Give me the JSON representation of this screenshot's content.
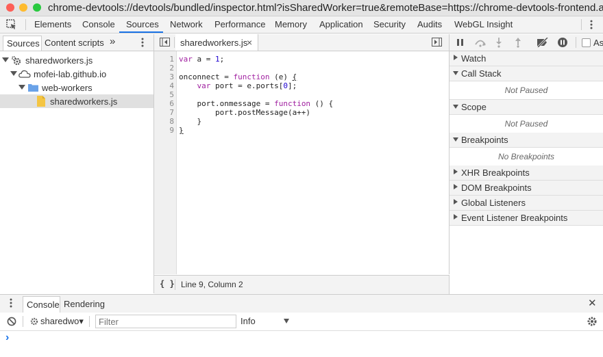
{
  "window": {
    "title": "chrome-devtools://devtools/bundled/inspector.html?isSharedWorker=true&remoteBase=https://chrome-devtools-frontend.appspo..."
  },
  "main_tabs": [
    {
      "label": "Elements"
    },
    {
      "label": "Console"
    },
    {
      "label": "Sources"
    },
    {
      "label": "Network"
    },
    {
      "label": "Performance"
    },
    {
      "label": "Memory"
    },
    {
      "label": "Application"
    },
    {
      "label": "Security"
    },
    {
      "label": "Audits"
    },
    {
      "label": "WebGL Insight"
    }
  ],
  "navigator": {
    "tabs": [
      {
        "label": "Sources"
      },
      {
        "label": "Content scripts"
      }
    ],
    "more": "»",
    "tree": [
      {
        "label": "sharedworkers.js",
        "icon": "gear-icon"
      },
      {
        "label": "mofei-lab.github.io",
        "icon": "cloud-icon"
      },
      {
        "label": "web-workers",
        "icon": "folder-icon"
      },
      {
        "label": "sharedworkers.js",
        "icon": "file-icon"
      }
    ]
  },
  "editor": {
    "tab_label": "sharedworkers.js",
    "close": "×",
    "line_numbers": [
      "1",
      "2",
      "3",
      "4",
      "5",
      "6",
      "7",
      "8",
      "9"
    ],
    "status": "Line 9, Column 2",
    "format_button": "{ }"
  },
  "debugger": {
    "checkbox_label": "As",
    "sections": {
      "watch": "Watch",
      "call_stack": "Call Stack",
      "call_stack_body": "Not Paused",
      "scope": "Scope",
      "scope_body": "Not Paused",
      "breakpoints": "Breakpoints",
      "breakpoints_body": "No Breakpoints",
      "xhr": "XHR Breakpoints",
      "dom": "DOM Breakpoints",
      "global": "Global Listeners",
      "event": "Event Listener Breakpoints"
    }
  },
  "drawer": {
    "tabs": [
      {
        "label": "Console"
      },
      {
        "label": "Rendering"
      }
    ],
    "close": "✕",
    "context": "sharedwo▾",
    "filter_placeholder": "Filter",
    "level": "Info",
    "prompt": "›"
  },
  "colors": {
    "accent": "#1a73e8",
    "keyword": "#a020a0",
    "number": "#1c00cf",
    "folder": "#6aa2e8",
    "file": "#f4c543"
  }
}
